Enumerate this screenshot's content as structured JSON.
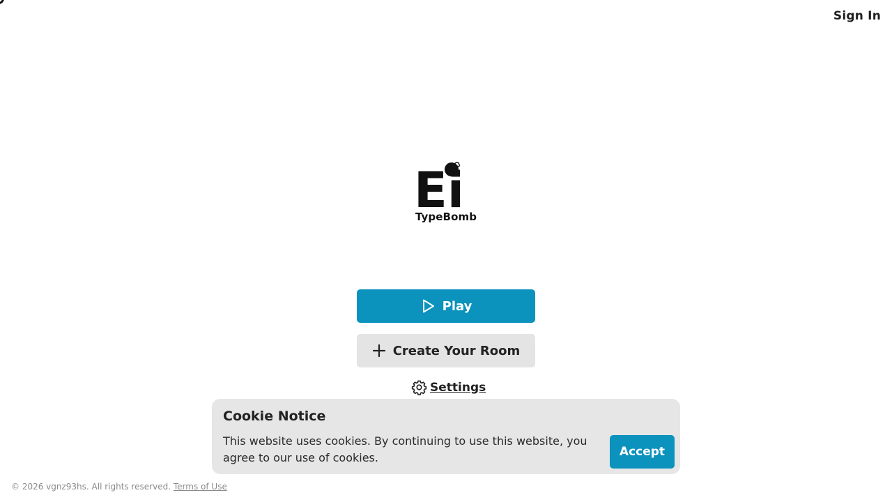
{
  "header": {
    "sign_in_label": "Sign In"
  },
  "logo": {
    "mark_text": "Ei",
    "brand_name": "TypeBomb",
    "icon": "bomb-icon"
  },
  "actions": {
    "play_label": "Play",
    "play_icon": "play-icon",
    "create_room_label": "Create Your Room",
    "create_room_icon": "plus-icon",
    "settings_label": "Settings",
    "settings_icon": "gear-icon"
  },
  "cookie_notice": {
    "title": "Cookie Notice",
    "message": "This website uses cookies. By continuing to use this website, you agree to our use of cookies.",
    "accept_label": "Accept"
  },
  "footer": {
    "copyright": "© 2026 vgnz93hs. All rights reserved.",
    "terms_label": "Terms of Use"
  },
  "colors": {
    "accent": "#0b92bd",
    "secondary_button": "#e4e4e4",
    "cookie_background": "#e6e6e6",
    "text": "#1f1f1f"
  }
}
